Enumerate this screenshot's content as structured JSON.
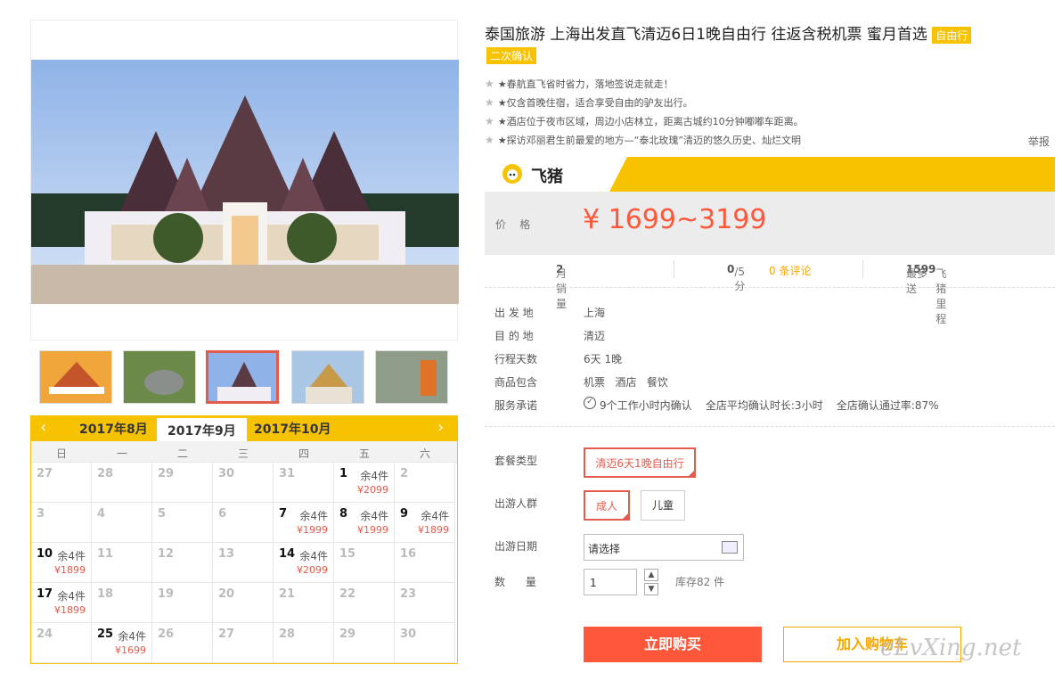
{
  "product": {
    "title": "泰国旅游 上海出发直飞清迈6日1晚自由行 往返含税机票 蜜月首选",
    "tag_free": "自由行",
    "tag_confirm": "二次确认",
    "features": [
      "★春航直飞省时省力，落地签说走就走！",
      "★仅含首晚住宿，适合享受自由的驴友出行。",
      "★酒店位于夜市区域，周边小店林立，距离古城约10分钟嘟嘟车距离。",
      "★探访邓丽君生前最爱的地方—“泰北玫瑰”清迈的悠久历史、灿烂文明"
    ],
    "report": "举报"
  },
  "price": {
    "brand": "飞猪",
    "label": "价    格",
    "value": "¥ 1699~3199"
  },
  "stats": {
    "monthly_label": "月销量",
    "monthly_value": "2",
    "rating_value": "0",
    "rating_max": "/5分",
    "reviews": "0 条评论",
    "miles_prefix": "最多送",
    "miles_value": "1599",
    "miles_suffix": "飞猪里程"
  },
  "info": [
    {
      "label": "出 发 地",
      "value": "上海"
    },
    {
      "label": "目 的 地",
      "value": "清迈"
    },
    {
      "label": "行程天数",
      "value": "6天 1晚"
    },
    {
      "label": "商品包含",
      "value": "机票   酒店   餐饮"
    },
    {
      "label": "服务承诺",
      "value": "9个工作小时内确认    全店平均确认时长:3小时    全店确认通过率:87%"
    }
  ],
  "options": {
    "package_label": "套餐类型",
    "package_value": "清迈6天1晚自由行",
    "crowd_label": "出游人群",
    "crowd_adult": "成人",
    "crowd_child": "儿童",
    "date_label": "出游日期",
    "date_placeholder": "请选择",
    "qty_label": "数      量",
    "qty_value": "1",
    "stock": "库存82 件"
  },
  "actions": {
    "buy": "立即购买",
    "cart": "加入购物车"
  },
  "watermark": "eLvXing.net",
  "calendar": {
    "prev_month": "2017年8月",
    "current_month": "2017年9月",
    "next_month": "2017年10月",
    "weekdays": [
      "日",
      "一",
      "二",
      "三",
      "四",
      "五",
      "六"
    ],
    "weeks": [
      [
        {
          "d": "27"
        },
        {
          "d": "28"
        },
        {
          "d": "29"
        },
        {
          "d": "30"
        },
        {
          "d": "31"
        },
        {
          "d": "1",
          "s": "余4件",
          "p": "¥2099"
        },
        {
          "d": "2"
        }
      ],
      [
        {
          "d": "3"
        },
        {
          "d": "4"
        },
        {
          "d": "5"
        },
        {
          "d": "6"
        },
        {
          "d": "7",
          "s": "余4件",
          "p": "¥1999"
        },
        {
          "d": "8",
          "s": "余4件",
          "p": "¥1999"
        },
        {
          "d": "9",
          "s": "余4件",
          "p": "¥1899"
        }
      ],
      [
        {
          "d": "10",
          "s": "余4件",
          "p": "¥1899"
        },
        {
          "d": "11"
        },
        {
          "d": "12"
        },
        {
          "d": "13"
        },
        {
          "d": "14",
          "s": "余4件",
          "p": "¥2099"
        },
        {
          "d": "15"
        },
        {
          "d": "16"
        }
      ],
      [
        {
          "d": "17",
          "s": "余4件",
          "p": "¥1899"
        },
        {
          "d": "18"
        },
        {
          "d": "19"
        },
        {
          "d": "20"
        },
        {
          "d": "21"
        },
        {
          "d": "22"
        },
        {
          "d": "23"
        }
      ],
      [
        {
          "d": "24"
        },
        {
          "d": "25",
          "s": "余4件",
          "p": "¥1699"
        },
        {
          "d": "26"
        },
        {
          "d": "27"
        },
        {
          "d": "28"
        },
        {
          "d": "29"
        },
        {
          "d": "30"
        }
      ]
    ]
  }
}
